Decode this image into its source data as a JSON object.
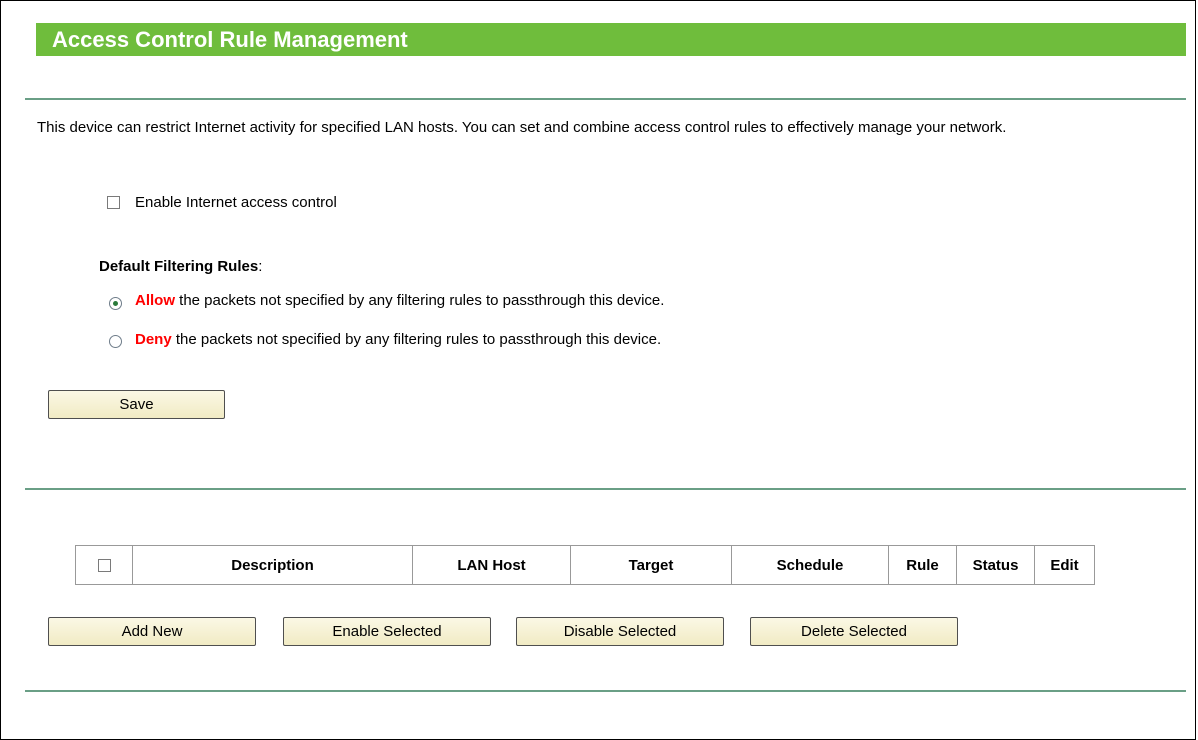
{
  "title": "Access Control Rule Management",
  "intro": "This device can restrict Internet activity for specified LAN hosts. You can set and combine access control rules to effectively manage your network.",
  "enable_control": {
    "label": "Enable Internet access control",
    "checked": false
  },
  "default_rules": {
    "heading": "Default Filtering Rules",
    "heading_suffix": ":",
    "allow": {
      "keyword": "Allow",
      "text": " the packets not specified by any filtering rules to passthrough this device.",
      "checked": true
    },
    "deny": {
      "keyword": "Deny",
      "text": " the packets not specified by any filtering rules to passthrough this device.",
      "checked": false
    }
  },
  "save_label": "Save",
  "table": {
    "columns": [
      "Description",
      "LAN Host",
      "Target",
      "Schedule",
      "Rule",
      "Status",
      "Edit"
    ]
  },
  "actions": {
    "add_new": "Add New",
    "enable_selected": "Enable Selected",
    "disable_selected": "Disable Selected",
    "delete_selected": "Delete Selected"
  },
  "colors": {
    "title_bar": "#6fbd3c",
    "divider": "#6a9f86",
    "emphasis": "#ff0000"
  }
}
